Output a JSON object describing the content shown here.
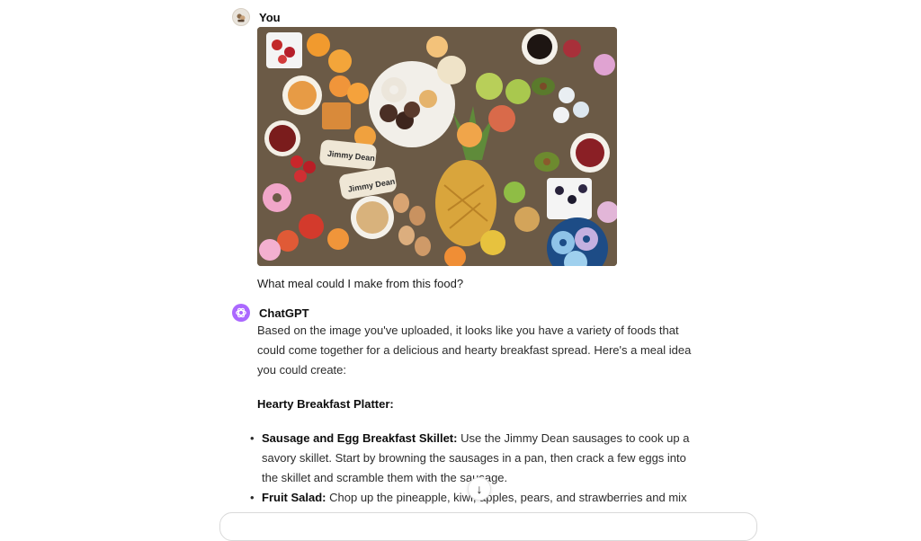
{
  "user_message": {
    "author": "You",
    "avatar_icon": "user-avatar-icon",
    "text": "What meal could I make from this food?"
  },
  "assistant_message": {
    "author": "ChatGPT",
    "avatar_icon": "openai-logo-icon",
    "intro": "Based on the image you've uploaded, it looks like you have a variety of foods that could come together for a delicious and hearty breakfast spread. Here's a meal idea you could create:",
    "heading": "Hearty Breakfast Platter:",
    "items": [
      {
        "title": "Sausage and Egg Breakfast Skillet:",
        "text": " Use the Jimmy Dean sausages to cook up a savory skillet. Start by browning the sausages in a pan, then crack a few eggs into the skillet and scramble them with the sausage."
      },
      {
        "title": "Fruit Salad:",
        "text": " Chop up the pineapple, kiwi, apples, pears, and strawberries and mix"
      }
    ]
  },
  "image_labels": {
    "sausage_brand": "Jimmy Dean"
  },
  "scroll_button_icon": "arrow-down-icon",
  "colors": {
    "assistant_avatar": "#ab68ff",
    "text": "#0d0d0d"
  }
}
